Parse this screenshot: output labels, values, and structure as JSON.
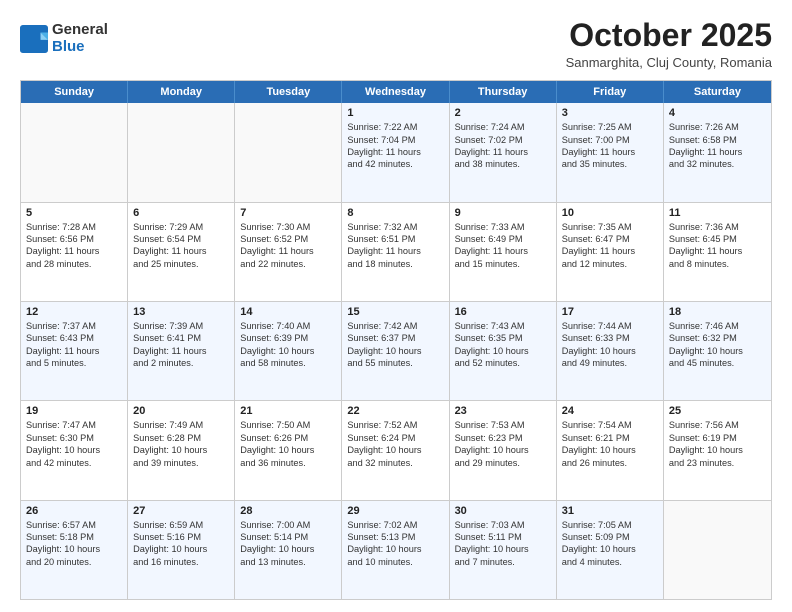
{
  "logo": {
    "general": "General",
    "blue": "Blue"
  },
  "title": "October 2025",
  "location": "Sanmarghita, Cluj County, Romania",
  "header_days": [
    "Sunday",
    "Monday",
    "Tuesday",
    "Wednesday",
    "Thursday",
    "Friday",
    "Saturday"
  ],
  "rows": [
    [
      {
        "day": "",
        "lines": [],
        "empty": true
      },
      {
        "day": "",
        "lines": [],
        "empty": true
      },
      {
        "day": "",
        "lines": [],
        "empty": true
      },
      {
        "day": "1",
        "lines": [
          "Sunrise: 7:22 AM",
          "Sunset: 7:04 PM",
          "Daylight: 11 hours",
          "and 42 minutes."
        ]
      },
      {
        "day": "2",
        "lines": [
          "Sunrise: 7:24 AM",
          "Sunset: 7:02 PM",
          "Daylight: 11 hours",
          "and 38 minutes."
        ]
      },
      {
        "day": "3",
        "lines": [
          "Sunrise: 7:25 AM",
          "Sunset: 7:00 PM",
          "Daylight: 11 hours",
          "and 35 minutes."
        ]
      },
      {
        "day": "4",
        "lines": [
          "Sunrise: 7:26 AM",
          "Sunset: 6:58 PM",
          "Daylight: 11 hours",
          "and 32 minutes."
        ]
      }
    ],
    [
      {
        "day": "5",
        "lines": [
          "Sunrise: 7:28 AM",
          "Sunset: 6:56 PM",
          "Daylight: 11 hours",
          "and 28 minutes."
        ]
      },
      {
        "day": "6",
        "lines": [
          "Sunrise: 7:29 AM",
          "Sunset: 6:54 PM",
          "Daylight: 11 hours",
          "and 25 minutes."
        ]
      },
      {
        "day": "7",
        "lines": [
          "Sunrise: 7:30 AM",
          "Sunset: 6:52 PM",
          "Daylight: 11 hours",
          "and 22 minutes."
        ]
      },
      {
        "day": "8",
        "lines": [
          "Sunrise: 7:32 AM",
          "Sunset: 6:51 PM",
          "Daylight: 11 hours",
          "and 18 minutes."
        ]
      },
      {
        "day": "9",
        "lines": [
          "Sunrise: 7:33 AM",
          "Sunset: 6:49 PM",
          "Daylight: 11 hours",
          "and 15 minutes."
        ]
      },
      {
        "day": "10",
        "lines": [
          "Sunrise: 7:35 AM",
          "Sunset: 6:47 PM",
          "Daylight: 11 hours",
          "and 12 minutes."
        ]
      },
      {
        "day": "11",
        "lines": [
          "Sunrise: 7:36 AM",
          "Sunset: 6:45 PM",
          "Daylight: 11 hours",
          "and 8 minutes."
        ]
      }
    ],
    [
      {
        "day": "12",
        "lines": [
          "Sunrise: 7:37 AM",
          "Sunset: 6:43 PM",
          "Daylight: 11 hours",
          "and 5 minutes."
        ]
      },
      {
        "day": "13",
        "lines": [
          "Sunrise: 7:39 AM",
          "Sunset: 6:41 PM",
          "Daylight: 11 hours",
          "and 2 minutes."
        ]
      },
      {
        "day": "14",
        "lines": [
          "Sunrise: 7:40 AM",
          "Sunset: 6:39 PM",
          "Daylight: 10 hours",
          "and 58 minutes."
        ]
      },
      {
        "day": "15",
        "lines": [
          "Sunrise: 7:42 AM",
          "Sunset: 6:37 PM",
          "Daylight: 10 hours",
          "and 55 minutes."
        ]
      },
      {
        "day": "16",
        "lines": [
          "Sunrise: 7:43 AM",
          "Sunset: 6:35 PM",
          "Daylight: 10 hours",
          "and 52 minutes."
        ]
      },
      {
        "day": "17",
        "lines": [
          "Sunrise: 7:44 AM",
          "Sunset: 6:33 PM",
          "Daylight: 10 hours",
          "and 49 minutes."
        ]
      },
      {
        "day": "18",
        "lines": [
          "Sunrise: 7:46 AM",
          "Sunset: 6:32 PM",
          "Daylight: 10 hours",
          "and 45 minutes."
        ]
      }
    ],
    [
      {
        "day": "19",
        "lines": [
          "Sunrise: 7:47 AM",
          "Sunset: 6:30 PM",
          "Daylight: 10 hours",
          "and 42 minutes."
        ]
      },
      {
        "day": "20",
        "lines": [
          "Sunrise: 7:49 AM",
          "Sunset: 6:28 PM",
          "Daylight: 10 hours",
          "and 39 minutes."
        ]
      },
      {
        "day": "21",
        "lines": [
          "Sunrise: 7:50 AM",
          "Sunset: 6:26 PM",
          "Daylight: 10 hours",
          "and 36 minutes."
        ]
      },
      {
        "day": "22",
        "lines": [
          "Sunrise: 7:52 AM",
          "Sunset: 6:24 PM",
          "Daylight: 10 hours",
          "and 32 minutes."
        ]
      },
      {
        "day": "23",
        "lines": [
          "Sunrise: 7:53 AM",
          "Sunset: 6:23 PM",
          "Daylight: 10 hours",
          "and 29 minutes."
        ]
      },
      {
        "day": "24",
        "lines": [
          "Sunrise: 7:54 AM",
          "Sunset: 6:21 PM",
          "Daylight: 10 hours",
          "and 26 minutes."
        ]
      },
      {
        "day": "25",
        "lines": [
          "Sunrise: 7:56 AM",
          "Sunset: 6:19 PM",
          "Daylight: 10 hours",
          "and 23 minutes."
        ]
      }
    ],
    [
      {
        "day": "26",
        "lines": [
          "Sunrise: 6:57 AM",
          "Sunset: 5:18 PM",
          "Daylight: 10 hours",
          "and 20 minutes."
        ]
      },
      {
        "day": "27",
        "lines": [
          "Sunrise: 6:59 AM",
          "Sunset: 5:16 PM",
          "Daylight: 10 hours",
          "and 16 minutes."
        ]
      },
      {
        "day": "28",
        "lines": [
          "Sunrise: 7:00 AM",
          "Sunset: 5:14 PM",
          "Daylight: 10 hours",
          "and 13 minutes."
        ]
      },
      {
        "day": "29",
        "lines": [
          "Sunrise: 7:02 AM",
          "Sunset: 5:13 PM",
          "Daylight: 10 hours",
          "and 10 minutes."
        ]
      },
      {
        "day": "30",
        "lines": [
          "Sunrise: 7:03 AM",
          "Sunset: 5:11 PM",
          "Daylight: 10 hours",
          "and 7 minutes."
        ]
      },
      {
        "day": "31",
        "lines": [
          "Sunrise: 7:05 AM",
          "Sunset: 5:09 PM",
          "Daylight: 10 hours",
          "and 4 minutes."
        ]
      },
      {
        "day": "",
        "lines": [],
        "empty": true
      }
    ]
  ],
  "alt_rows": [
    0,
    2,
    4
  ]
}
